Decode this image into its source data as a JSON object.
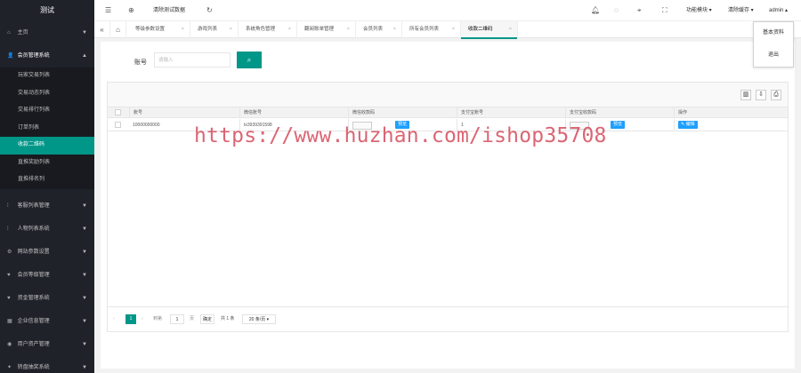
{
  "app": {
    "logo": "测试"
  },
  "sidebar": {
    "items_top": [
      {
        "label": "主页",
        "icon": "home-icon"
      },
      {
        "label": "会员管理系统",
        "icon": "users-icon"
      }
    ],
    "sub_items": [
      {
        "label": "玩家交易列表"
      },
      {
        "label": "交易动态列表"
      },
      {
        "label": "交易排行列表"
      },
      {
        "label": "订单列表"
      },
      {
        "label": "收款二维码"
      },
      {
        "label": "直推奖励列表"
      },
      {
        "label": "直推排名列"
      }
    ],
    "items_bottom": [
      {
        "label": "客服列表管理",
        "icon": "dot-icon"
      },
      {
        "label": "人物列表系统",
        "icon": "dot-icon"
      },
      {
        "label": "网站参数设置",
        "icon": "gear-icon"
      },
      {
        "label": "会员等级管理",
        "icon": "heart-icon"
      },
      {
        "label": "资金管理系统",
        "icon": "heart-icon"
      },
      {
        "label": "企业信息管理",
        "icon": "building-icon"
      },
      {
        "label": "用户资产管理",
        "icon": "wallet-icon"
      },
      {
        "label": "转盘抽奖系统",
        "icon": "gift-icon"
      }
    ]
  },
  "header": {
    "clear_test_data": "清除测试数据",
    "function_module": "功能模块",
    "clear_cache": "清除缓存",
    "user": "admin"
  },
  "tabs": [
    {
      "label": "等级参数设置"
    },
    {
      "label": "游戏列表"
    },
    {
      "label": "系统角色管理"
    },
    {
      "label": "翻阅账单管理"
    },
    {
      "label": "会员列表"
    },
    {
      "label": "所有会员列表"
    },
    {
      "label": "收款二维码"
    }
  ],
  "dropdown": {
    "items": [
      {
        "label": "基本资料"
      },
      {
        "label": "退出"
      }
    ]
  },
  "search": {
    "label": "账号",
    "placeholder": "请输入"
  },
  "table": {
    "columns": [
      "账号",
      "微信账号",
      "微信收款码",
      "支付宝账号",
      "支付宝收款码",
      "操作"
    ],
    "rows": [
      {
        "account": "10000000000",
        "wechat": "tx3939391598",
        "wechat_btn": "预览",
        "alipay": "1",
        "alipay_btn": "预览",
        "edit_btn": "✎ 编辑"
      }
    ]
  },
  "pager": {
    "current_page": "1",
    "goto_label": "到第",
    "goto_value": "1",
    "page_unit": "页",
    "confirm": "确定",
    "total": "共 1 条",
    "per_page": "20 条/页"
  },
  "watermark": "https://www.huzhan.com/ishop35708",
  "colors": {
    "accent": "#009688",
    "sidebar": "#20222a",
    "blue_button": "#1e9fff",
    "watermark": "#d23a4c"
  }
}
